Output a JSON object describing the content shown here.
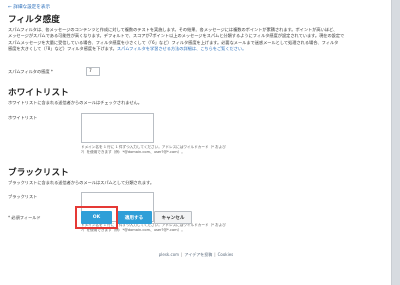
{
  "back_link": "← 詳細な設定を表示",
  "filter": {
    "title": "フィルタ感度",
    "description_lines": [
      "スパムフィルタは、各メッセージのコンテンツと作成に対して複数のテストを実施します。その結果、各メッセージには複数のポイントが累積されます。ポイントが高いほど、",
      "メッセージがスパムである可能性が高くなります。デフォルトで、スコアが7ポイント以上のメッセージをスパムと分類するようにフィルタ感度が設定されています。現在の設定で",
      "スパムメッセージを大量に受信している場合、フィルタ感度を小さくして（「6」など）フィルタ感度を上げます。必要なメールまで迷惑メールとして処理される場合、フィルタ"
    ],
    "description_tail": "感度を大きくして（「8」など）フィルタ感度を下げます。",
    "description_link": "スパムフィルタを学習させる方法の詳細は、こちらをご覧ください。",
    "sensitivity_label": "スパムフィルタの感度 *",
    "sensitivity_value": "7"
  },
  "whitelist": {
    "title": "ホワイトリスト",
    "description": "ホワイトリストに含まれる送信者からのメールはチェックされません。",
    "field_label": "ホワイトリスト",
    "help_lines": [
      "ドメイン名を 1 行に 1 件ずつ入力してください。アドレスにはワイルドカード（* および",
      "?）を使用できます（例：*@domain.com、user?@*.com）。"
    ]
  },
  "blacklist": {
    "title": "ブラックリスト",
    "description": "ブラックリストに含まれる送信者からのメールはスパムとして分類されます。",
    "field_label": "ブラックリスト",
    "help_lines": [
      "ドメイン名を 1 行に 1 件ずつ入力してください。アドレスにはワイルドカード（* および",
      "?）を使用できます（例：*@domain.com、user?@*.com）。"
    ]
  },
  "required_label": "* 必須フィールド",
  "buttons": {
    "ok": "OK",
    "save": "適用する",
    "cancel": "キャンセル"
  },
  "footer": {
    "brand": "plesk.com",
    "feedback": "アイデアを投稿",
    "cookies": "Cookies",
    "separator": "|"
  }
}
